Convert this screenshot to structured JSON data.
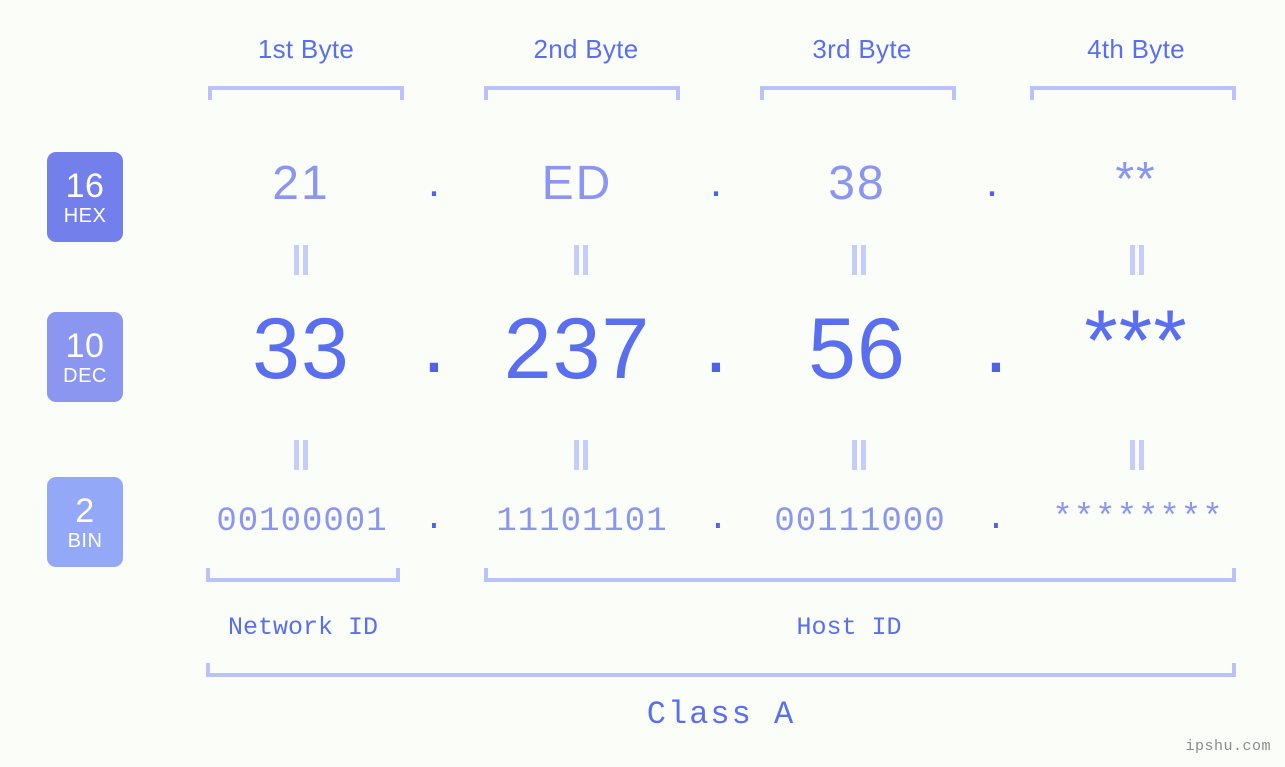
{
  "meta": {
    "watermark": "ipshu.com",
    "accent_strong": "#5a6ff0",
    "accent_mid": "#8b96f0",
    "accent_light": "#b9c2fb",
    "background": "#fbfdf8"
  },
  "byte_headers": [
    {
      "label": "1st Byte"
    },
    {
      "label": "2nd Byte"
    },
    {
      "label": "3rd Byte"
    },
    {
      "label": "4th Byte"
    }
  ],
  "radix_badges": [
    {
      "number": "16",
      "abbr": "HEX",
      "color": "#7380ec"
    },
    {
      "number": "10",
      "abbr": "DEC",
      "color": "#8b96f0"
    },
    {
      "number": "2",
      "abbr": "BIN",
      "color": "#93a8f7"
    }
  ],
  "rows": {
    "hex": {
      "values": [
        "21",
        "ED",
        "38",
        "**"
      ],
      "separators": [
        ".",
        ".",
        "."
      ]
    },
    "dec": {
      "values": [
        "33",
        "237",
        "56",
        "***"
      ],
      "separators": [
        ".",
        ".",
        "."
      ]
    },
    "bin": {
      "values": [
        "00100001",
        "11101101",
        "00111000",
        "********"
      ],
      "separators": [
        ".",
        ".",
        "."
      ]
    }
  },
  "segments": {
    "network_id": "Network ID",
    "host_id": "Host ID",
    "class": "Class A"
  }
}
